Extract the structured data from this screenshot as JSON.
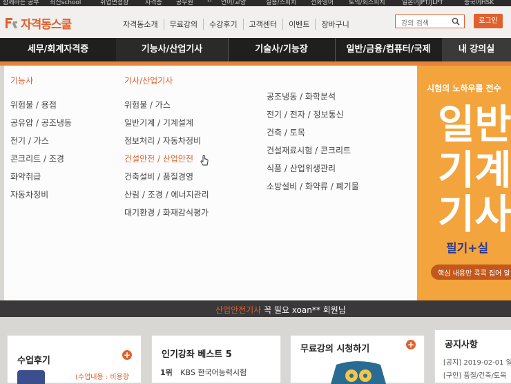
{
  "top_strip": [
    "함께하는 공부",
    "최신school",
    "취업면접장",
    "자격증",
    "공무원",
    "IT",
    "언어/교양",
    "실용/스피치",
    "전화영어",
    "토익/회스피치",
    "일본어JPT/JLPT",
    "중국어HSK"
  ],
  "header": {
    "logo_text": "자격동스쿨",
    "nav": [
      "자격동소개",
      "무료강의",
      "수강후기",
      "고객센터",
      "이벤트",
      "장바구니"
    ],
    "search_placeholder": "강의 검색",
    "login_label": "로그인"
  },
  "main_nav": [
    "세무/회계자격증",
    "기능사/산업기사",
    "기술사/기능장",
    "일반/금융/컴퓨터/국제",
    "내 강의실"
  ],
  "dropdown": {
    "col1": {
      "heading": "기능사",
      "items": [
        "위험물 / 용접",
        "공유압 / 공조냉동",
        "전기 / 가스",
        "콘크리트 / 조경",
        "화약취급",
        "자동차정비"
      ]
    },
    "col2": {
      "heading": "기사/산업기사",
      "items": [
        "위험물 / 가스",
        "일반기계 / 기계설계",
        "정보처리 / 자동차정비",
        "건설안전 / 산업안전",
        "건축설비 / 품질경영",
        "산림 / 조경 / 에너지관리",
        "대기환경 / 화재감식평가"
      ]
    },
    "col3": {
      "items": [
        "공조냉동 / 화학분석",
        "전기 / 전자 / 정보통신",
        "건축 / 토목",
        "건설재료시험 / 콘크리트",
        "식품 / 산업위생관리",
        "소방설비 / 화약류 / 폐기물"
      ]
    }
  },
  "banner": {
    "line1": "시험의 노하우를 전수",
    "big1": "일반",
    "big2": "기계",
    "big3": "기사",
    "line3": "필기+실",
    "pill": "핵심 내용만 콕콕 집어 알"
  },
  "ticker": {
    "prefix": "산업안전기사",
    "mid": " 꼭 필요 ",
    "user": "xoan** 회원님"
  },
  "cards": [
    {
      "title": "수업후기",
      "sub": "(수업내용 : 비용항"
    },
    {
      "title": "인기강좌 베스트 5",
      "rank": "1위",
      "item": "KBS 한국어능력시험"
    },
    {
      "title": "무료강의 시청하기"
    },
    {
      "title": "공지사항",
      "notices": [
        "[공지] 2019-02-01 일",
        "[구인] 품질/건축/토목"
      ]
    }
  ],
  "colors": {
    "accent": "#e0612d",
    "nav_bg": "#1f1f1f",
    "banner_bg": "#f3a43d"
  }
}
